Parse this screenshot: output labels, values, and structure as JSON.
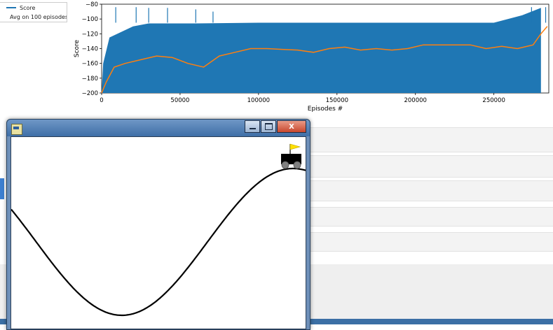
{
  "plot": {
    "legend": [
      {
        "label": "Score",
        "color": "#1f77b4"
      },
      {
        "label": "Avg on 100 episodes",
        "color": "#ff7f0e"
      }
    ]
  },
  "chart_data": {
    "type": "line",
    "xlabel": "Episodes #",
    "ylabel": "Score",
    "xlim": [
      0,
      285000
    ],
    "ylim": [
      -200,
      -80
    ],
    "xticks": [
      "0",
      "50000",
      "100000",
      "150000",
      "200000",
      "250000"
    ],
    "yticks": [
      "−80",
      "−100",
      "−120",
      "−140",
      "−160",
      "−180",
      "−200"
    ],
    "series": [
      {
        "name": "Score",
        "color": "#1f77b4",
        "band": [
          {
            "x": 0,
            "min": -200,
            "max": -200
          },
          {
            "x": 1000,
            "min": -200,
            "max": -160
          },
          {
            "x": 5000,
            "min": -200,
            "max": -125
          },
          {
            "x": 20000,
            "min": -200,
            "max": -110
          },
          {
            "x": 30000,
            "min": -200,
            "max": -106
          },
          {
            "x": 60000,
            "min": -200,
            "max": -106
          },
          {
            "x": 100000,
            "min": -200,
            "max": -105
          },
          {
            "x": 150000,
            "min": -200,
            "max": -105
          },
          {
            "x": 200000,
            "min": -200,
            "max": -105
          },
          {
            "x": 250000,
            "min": -200,
            "max": -105
          },
          {
            "x": 268000,
            "min": -200,
            "max": -95
          },
          {
            "x": 280000,
            "min": -200,
            "max": -85
          }
        ],
        "spikes": [
          {
            "x": 9000,
            "y": -84
          },
          {
            "x": 22000,
            "y": -84
          },
          {
            "x": 30000,
            "y": -85
          },
          {
            "x": 42000,
            "y": -85
          },
          {
            "x": 60000,
            "y": -87
          },
          {
            "x": 71000,
            "y": -90
          },
          {
            "x": 274000,
            "y": -84
          },
          {
            "x": 283000,
            "y": -84
          }
        ]
      },
      {
        "name": "Avg on 100 episodes",
        "color": "#ff7f0e",
        "x": [
          0,
          3000,
          8000,
          15000,
          25000,
          35000,
          45000,
          55000,
          65000,
          75000,
          85000,
          95000,
          105000,
          115000,
          125000,
          135000,
          145000,
          155000,
          165000,
          175000,
          185000,
          195000,
          205000,
          215000,
          225000,
          235000,
          245000,
          255000,
          265000,
          275000,
          280000,
          284000
        ],
        "y": [
          -200,
          -185,
          -165,
          -160,
          -155,
          -150,
          -152,
          -160,
          -165,
          -150,
          -145,
          -140,
          -140,
          -141,
          -142,
          -145,
          -140,
          -138,
          -142,
          -140,
          -142,
          -140,
          -135,
          -135,
          -135,
          -135,
          -140,
          -137,
          -140,
          -135,
          -120,
          -110
        ]
      }
    ]
  },
  "window": {
    "title": "",
    "controls": {
      "minimize": "minimize",
      "maximize": "maximize",
      "close": "X"
    }
  },
  "scene": {
    "curve_color": "#000000",
    "flag_color": "#ffe000",
    "cart_color": "#000000",
    "wheel_color": "#808080"
  }
}
